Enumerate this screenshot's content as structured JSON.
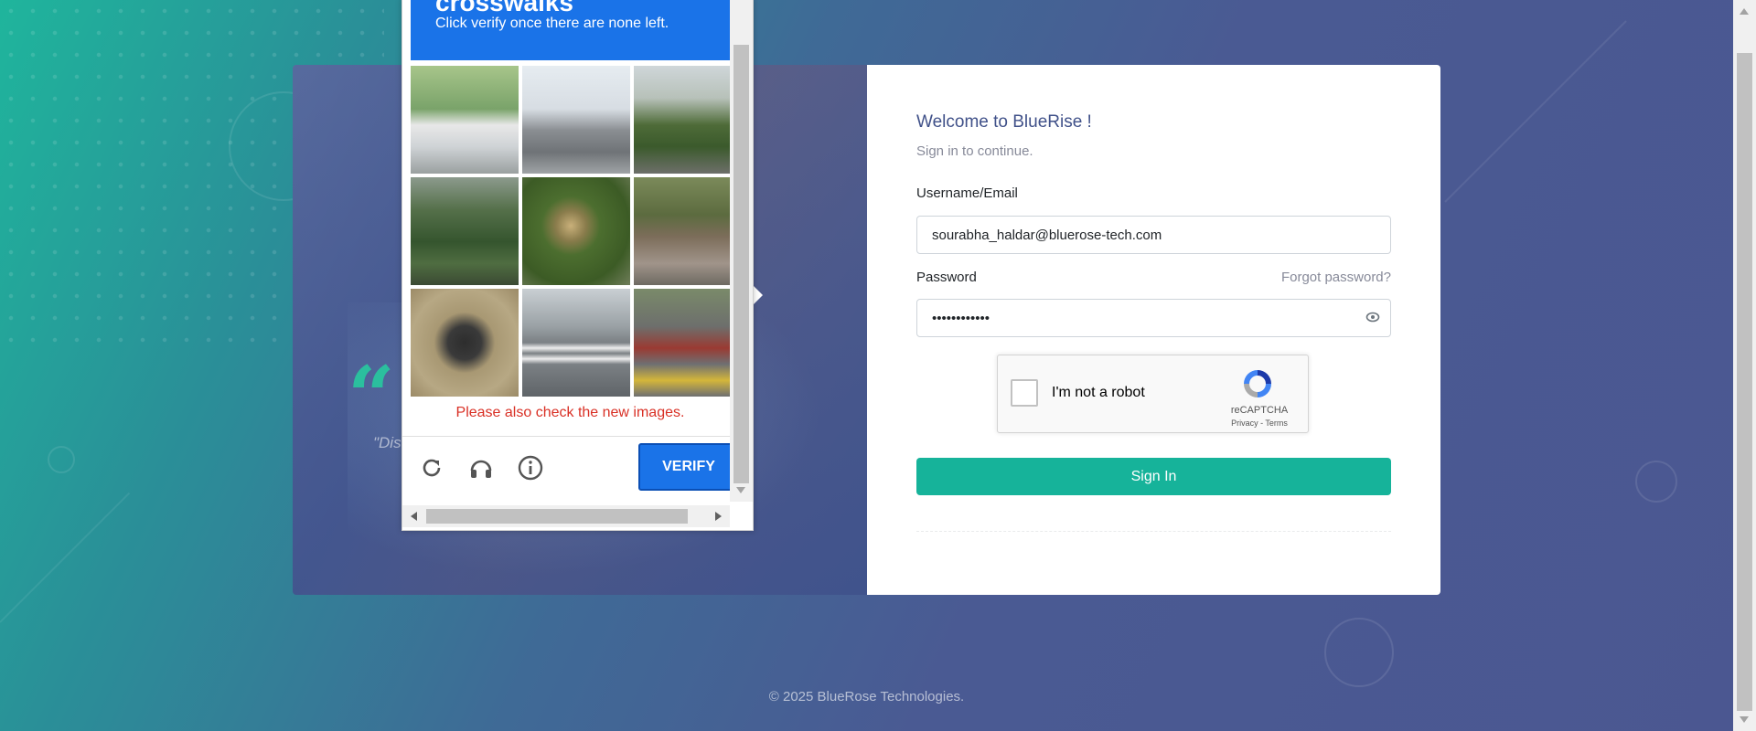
{
  "login": {
    "welcome": "Welcome to BlueRise !",
    "subtitle": "Sign in to continue.",
    "username_label": "Username/Email",
    "username_value": "sourabha_haldar@bluerose-tech.com",
    "password_label": "Password",
    "password_value": "••••••••••••",
    "forgot_password": "Forgot password?",
    "sign_in": "Sign In"
  },
  "recaptcha": {
    "label": "I'm not a robot",
    "brand": "reCAPTCHA",
    "links": "Privacy - Terms"
  },
  "challenge": {
    "title": "crosswalks",
    "instruction": "Click verify once there are none left.",
    "error": "Please also check the new images.",
    "verify": "VERIFY",
    "tiles": [
      "bicycle-fence",
      "cars-traffic-lights",
      "road-hills",
      "green-mountain",
      "fire-hydrant-bushes",
      "street-shop",
      "motorcycle-rider",
      "road-crosswalk",
      "scooter-parked"
    ]
  },
  "quote": {
    "text": "\"Dis                                                on or"
  },
  "footer": {
    "copyright": "© 2025 BlueRose Technologies."
  },
  "colors": {
    "primary": "#405189",
    "success": "#16b39a",
    "captcha_blue": "#1a73e8",
    "error_red": "#d93025"
  }
}
